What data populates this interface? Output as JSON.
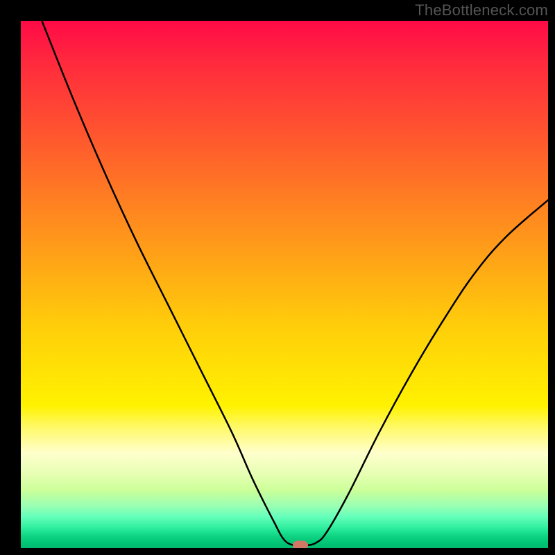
{
  "attribution": "TheBottleneck.com",
  "chart_data": {
    "type": "line",
    "title": "",
    "xlabel": "",
    "ylabel": "",
    "xlim": [
      0,
      100
    ],
    "ylim": [
      0,
      100
    ],
    "curve": [
      {
        "x": 4,
        "y": 100
      },
      {
        "x": 10,
        "y": 85
      },
      {
        "x": 16,
        "y": 71
      },
      {
        "x": 22,
        "y": 58
      },
      {
        "x": 28,
        "y": 46
      },
      {
        "x": 34,
        "y": 34
      },
      {
        "x": 40,
        "y": 22
      },
      {
        "x": 44,
        "y": 13
      },
      {
        "x": 48,
        "y": 5
      },
      {
        "x": 50,
        "y": 1.5
      },
      {
        "x": 52,
        "y": 0.5
      },
      {
        "x": 54,
        "y": 0.5
      },
      {
        "x": 56,
        "y": 1
      },
      {
        "x": 58,
        "y": 3
      },
      {
        "x": 62,
        "y": 10
      },
      {
        "x": 68,
        "y": 22
      },
      {
        "x": 74,
        "y": 33
      },
      {
        "x": 80,
        "y": 43
      },
      {
        "x": 86,
        "y": 52
      },
      {
        "x": 92,
        "y": 59
      },
      {
        "x": 100,
        "y": 66
      }
    ],
    "marker": {
      "x": 53,
      "y": 0.5,
      "color": "#d17865"
    },
    "gradient_stops": [
      {
        "pct": 0,
        "color": "#ff0a47"
      },
      {
        "pct": 50,
        "color": "#ffce0a"
      },
      {
        "pct": 78,
        "color": "#fff966"
      },
      {
        "pct": 100,
        "color": "#00ba70"
      }
    ]
  }
}
